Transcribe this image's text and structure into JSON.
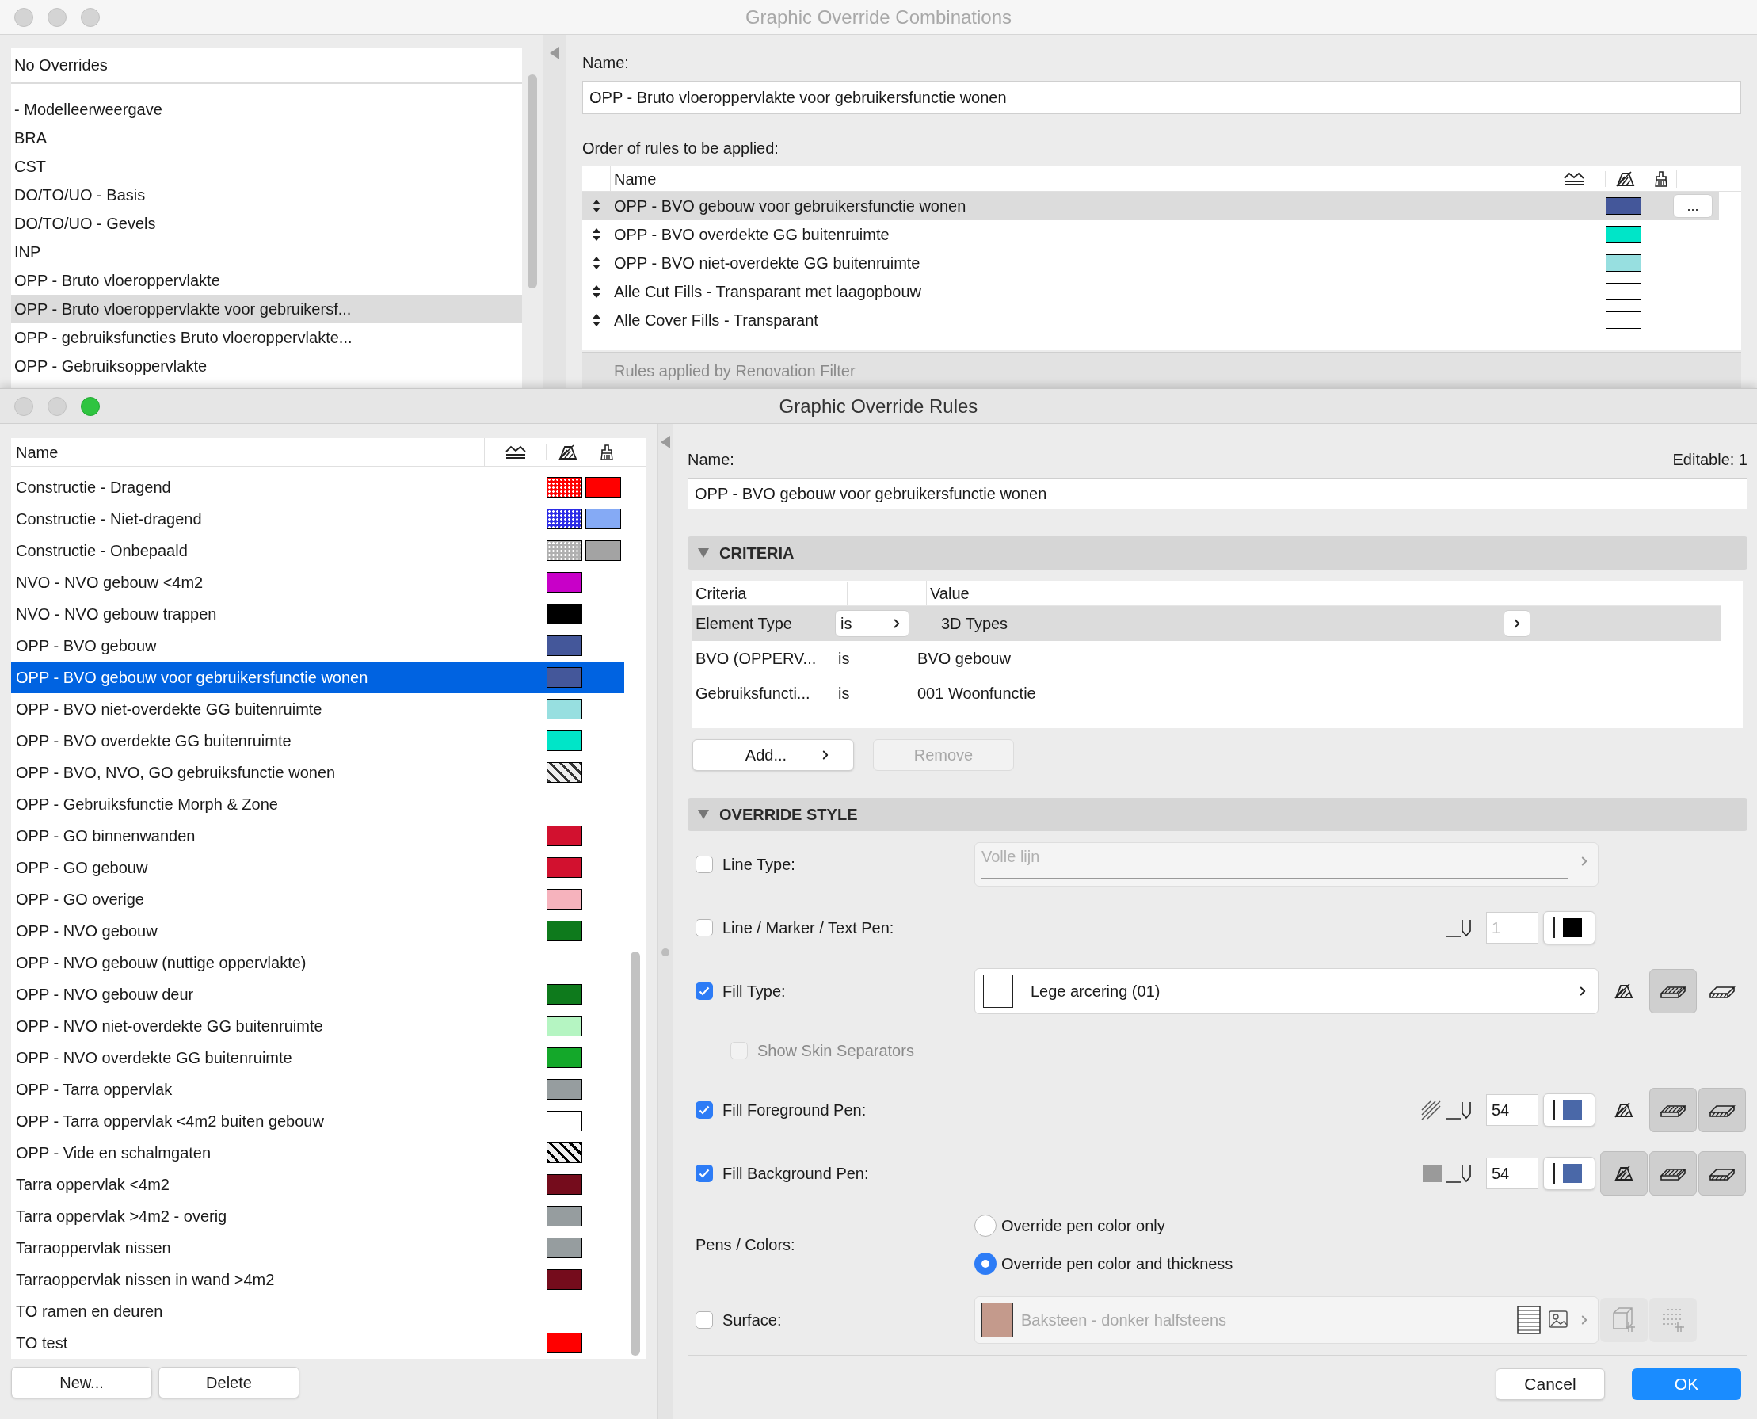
{
  "combinations_window": {
    "title": "Graphic Override Combinations",
    "default_item": "No Overrides",
    "list": [
      {
        "label": "- Modelleerweergave",
        "selected": false
      },
      {
        "label": "BRA",
        "selected": false
      },
      {
        "label": "CST",
        "selected": false
      },
      {
        "label": "DO/TO/UO - Basis",
        "selected": false
      },
      {
        "label": "DO/TO/UO - Gevels",
        "selected": false
      },
      {
        "label": "INP",
        "selected": false
      },
      {
        "label": "OPP - Bruto vloeroppervlakte",
        "selected": false
      },
      {
        "label": "OPP - Bruto vloeroppervlakte voor gebruikersf...",
        "selected": true
      },
      {
        "label": "OPP - gebruiksfuncties Bruto vloeroppervlakte...",
        "selected": false
      },
      {
        "label": "OPP - Gebruiksoppervlakte",
        "selected": false
      }
    ],
    "name_label": "Name:",
    "name_value": "OPP - Bruto vloeroppervlakte voor gebruikersfunctie wonen",
    "rules_label": "Order of rules to be applied:",
    "rules_table": {
      "columns": [
        "Name"
      ],
      "rows": [
        {
          "name": "OPP - BVO gebouw voor gebruikersfunctie wonen",
          "color": "#44579a",
          "selected": true
        },
        {
          "name": "OPP - BVO overdekte GG buitenruimte",
          "color": "#00e5c8",
          "selected": false
        },
        {
          "name": "OPP - BVO niet-overdekte GG buitenruimte",
          "color": "#97dfe0",
          "selected": false
        },
        {
          "name": "Alle Cut Fills - Transparant met laagopbouw",
          "color": "#ffffff",
          "selected": false
        },
        {
          "name": "Alle Cover Fills - Transparant",
          "color": "#ffffff",
          "selected": false
        }
      ]
    },
    "more_button": "...",
    "renovation_label": "Rules applied by Renovation Filter"
  },
  "rules_window": {
    "title": "Graphic Override Rules",
    "list_columns": [
      "Name"
    ],
    "rules": [
      {
        "name": "Constructie - Dragend",
        "selected": false,
        "swatches": [
          {
            "kind": "dotted",
            "color": "#ff0000"
          },
          {
            "kind": "solid",
            "color": "#ff0000"
          }
        ]
      },
      {
        "name": "Constructie - Niet-dragend",
        "selected": false,
        "swatches": [
          {
            "kind": "dotted",
            "color": "#2b2be6"
          },
          {
            "kind": "solid",
            "color": "#85aaf5"
          }
        ]
      },
      {
        "name": "Constructie - Onbepaald",
        "selected": false,
        "swatches": [
          {
            "kind": "dotted",
            "color": "#b0b0b0"
          },
          {
            "kind": "solid",
            "color": "#a3a3a3"
          }
        ]
      },
      {
        "name": "NVO - NVO gebouw <4m2",
        "selected": false,
        "swatches": [
          {
            "kind": "solid",
            "color": "#c800c8"
          }
        ]
      },
      {
        "name": "NVO - NVO gebouw trappen",
        "selected": false,
        "swatches": [
          {
            "kind": "solid",
            "color": "#000000"
          }
        ]
      },
      {
        "name": "OPP - BVO gebouw",
        "selected": false,
        "swatches": [
          {
            "kind": "solid",
            "color": "#44579a"
          }
        ]
      },
      {
        "name": "OPP - BVO gebouw voor gebruikersfunctie wonen",
        "selected": true,
        "swatches": [
          {
            "kind": "solid",
            "color": "#44579a"
          }
        ]
      },
      {
        "name": "OPP - BVO niet-overdekte GG buitenruimte",
        "selected": false,
        "swatches": [
          {
            "kind": "solid",
            "color": "#97dfe0"
          }
        ]
      },
      {
        "name": "OPP - BVO overdekte GG buitenruimte",
        "selected": false,
        "swatches": [
          {
            "kind": "solid",
            "color": "#00e5c8"
          }
        ]
      },
      {
        "name": "OPP - BVO, NVO, GO gebruiksfunctie wonen",
        "selected": false,
        "swatches": [
          {
            "kind": "hatched",
            "color": "#333333"
          }
        ]
      },
      {
        "name": "OPP - Gebruiksfunctie Morph & Zone",
        "selected": false
      },
      {
        "name": "OPP - GO binnenwanden",
        "selected": false,
        "swatches": [
          {
            "kind": "solid",
            "color": "#d2112f"
          }
        ]
      },
      {
        "name": "OPP - GO gebouw",
        "selected": false,
        "swatches": [
          {
            "kind": "solid",
            "color": "#d2112f"
          }
        ]
      },
      {
        "name": "OPP - GO overige",
        "selected": false,
        "swatches": [
          {
            "kind": "solid",
            "color": "#f6b3bd"
          }
        ]
      },
      {
        "name": "OPP - NVO gebouw",
        "selected": false,
        "swatches": [
          {
            "kind": "solid",
            "color": "#0e7a1c"
          }
        ]
      },
      {
        "name": "OPP - NVO gebouw (nuttige oppervlakte)",
        "selected": false
      },
      {
        "name": "OPP - NVO gebouw deur",
        "selected": false,
        "swatches": [
          {
            "kind": "solid",
            "color": "#0e7a1c"
          }
        ]
      },
      {
        "name": "OPP - NVO niet-overdekte GG buitenruimte",
        "selected": false,
        "swatches": [
          {
            "kind": "solid",
            "color": "#b5f5c2"
          }
        ]
      },
      {
        "name": "OPP - NVO overdekte GG buitenruimte",
        "selected": false,
        "swatches": [
          {
            "kind": "solid",
            "color": "#14a82a"
          }
        ]
      },
      {
        "name": "OPP - Tarra oppervlak",
        "selected": false,
        "swatches": [
          {
            "kind": "solid",
            "color": "#969d9f"
          }
        ]
      },
      {
        "name": "OPP - Tarra oppervlak <4m2 buiten gebouw",
        "selected": false,
        "swatches": [
          {
            "kind": "solid",
            "color": "#ffffff"
          }
        ]
      },
      {
        "name": "OPP - Vide en schalmgaten",
        "selected": false,
        "swatches": [
          {
            "kind": "hatched",
            "color": "#000000"
          }
        ]
      },
      {
        "name": "Tarra oppervlak <4m2",
        "selected": false,
        "swatches": [
          {
            "kind": "solid",
            "color": "#750c1c"
          }
        ]
      },
      {
        "name": "Tarra oppervlak >4m2 - overig",
        "selected": false,
        "swatches": [
          {
            "kind": "solid",
            "color": "#969d9f"
          }
        ]
      },
      {
        "name": "Tarraoppervlak nissen",
        "selected": false,
        "swatches": [
          {
            "kind": "solid",
            "color": "#969d9f"
          }
        ]
      },
      {
        "name": "Tarraoppervlak nissen in wand >4m2",
        "selected": false,
        "swatches": [
          {
            "kind": "solid",
            "color": "#750c1c"
          }
        ]
      },
      {
        "name": "TO ramen en deuren",
        "selected": false
      },
      {
        "name": "TO test",
        "selected": false,
        "swatches": [
          {
            "kind": "solid",
            "color": "#ff0000"
          }
        ]
      }
    ],
    "list_buttons": [
      "New...",
      "Delete"
    ],
    "editor": {
      "name_label": "Name:",
      "editable": "Editable: 1",
      "name_value": "OPP - BVO gebouw voor gebruikersfunctie wonen",
      "criteria": {
        "title": "CRITERIA",
        "expanded": true,
        "columns": [
          "Criteria",
          "Value"
        ],
        "rows": [
          {
            "criterion": "Element Type",
            "operator": "is",
            "value": "3D Types",
            "selected": true
          },
          {
            "criterion": "BVO (OPPERV...",
            "operator": "is",
            "value": "BVO gebouw",
            "selected": false
          },
          {
            "criterion": "Gebruiksfuncti...",
            "operator": "is",
            "value": "001 Woonfunctie",
            "selected": false
          }
        ]
      },
      "add_button": {
        "label": "Add...",
        "disabled": false
      },
      "remove_button": {
        "label": "Remove",
        "disabled": true
      },
      "override_style": {
        "title": "OVERRIDE STYLE",
        "expanded": true,
        "rows": [
          {
            "kind": "line_type",
            "label": "Line Type:",
            "checked": false,
            "value": "Volle lijn"
          },
          {
            "kind": "line_pen",
            "label": "Line / Marker / Text Pen:",
            "checked": false,
            "pen": "1",
            "color": "#000000"
          },
          {
            "kind": "fill_type",
            "label": "Fill Type:",
            "checked": true,
            "value": "Lege arcering (01)",
            "toggles": [
              {
                "selected": false
              },
              {
                "selected": true
              },
              {
                "selected": false
              }
            ]
          },
          {
            "kind": "sub_option",
            "label": "Show Skin Separators",
            "checked": false,
            "disabled": true
          },
          {
            "kind": "foreground_pen",
            "label": "Fill Foreground Pen:",
            "checked": true,
            "pen": "54",
            "color": "#4a68a8",
            "toggles": [
              {
                "selected": false
              },
              {
                "selected": true
              },
              {
                "selected": true
              }
            ]
          },
          {
            "kind": "background_pen",
            "label": "Fill Background Pen:",
            "checked": true,
            "pen": "54",
            "color": "#4a68a8",
            "toggles": [
              {
                "selected": true
              },
              {
                "selected": true
              },
              {
                "selected": true
              }
            ]
          },
          {
            "kind": "radio",
            "label": "Pens / Colors:",
            "options": [
              {
                "label": "Override pen color only",
                "selected": false
              },
              {
                "label": "Override pen color and thickness",
                "selected": true
              }
            ]
          },
          {
            "kind": "surface",
            "label": "Surface:",
            "checked": false,
            "value": "Baksteen - donker halfsteens",
            "color": "#c49a8c"
          }
        ]
      },
      "buttons": [
        {
          "label": "Cancel",
          "kind": "default"
        },
        {
          "label": "OK",
          "kind": "primary"
        }
      ]
    }
  }
}
